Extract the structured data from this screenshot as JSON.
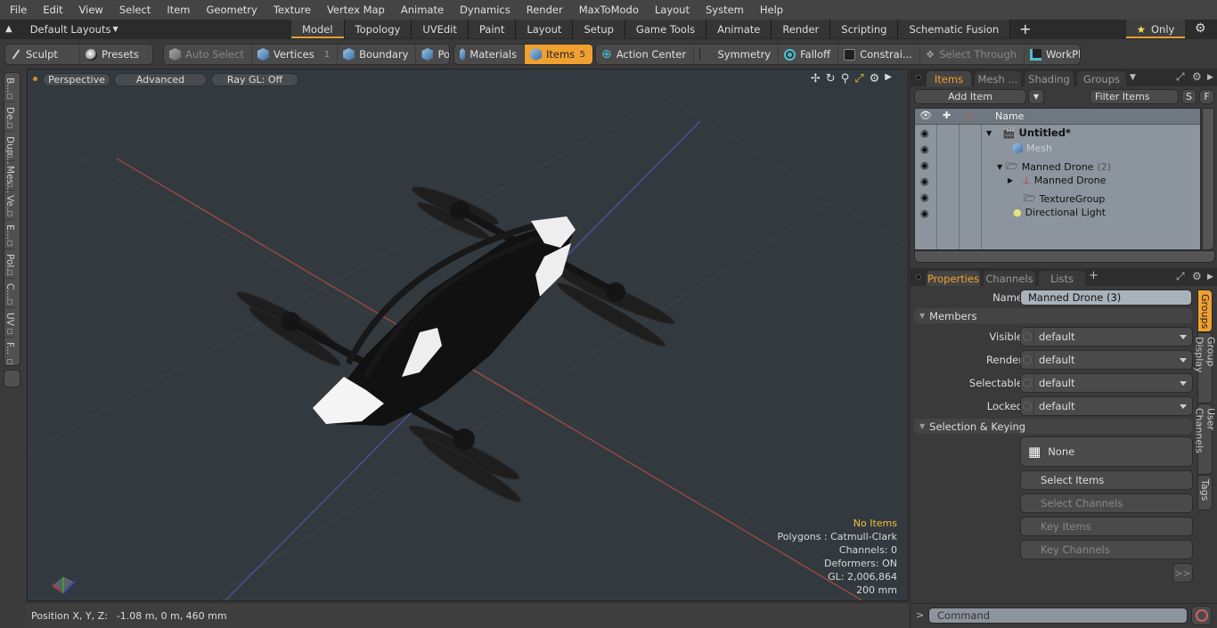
{
  "menu": [
    "File",
    "Edit",
    "View",
    "Select",
    "Item",
    "Geometry",
    "Texture",
    "Vertex Map",
    "Animate",
    "Dynamics",
    "Render",
    "MaxToModo",
    "Layout",
    "System",
    "Help"
  ],
  "layout_bar": {
    "layout_select": "Default Layouts",
    "tabs": [
      {
        "label": "Model",
        "active": true
      },
      {
        "label": "Topology"
      },
      {
        "label": "UVEdit"
      },
      {
        "label": "Paint"
      },
      {
        "label": "Layout"
      },
      {
        "label": "Setup"
      },
      {
        "label": "Game Tools"
      },
      {
        "label": "Animate"
      },
      {
        "label": "Render"
      },
      {
        "label": "Scripting"
      },
      {
        "label": "Schematic Fusion"
      }
    ],
    "add_tab": "+",
    "only_label": "Only"
  },
  "toolbar": {
    "sculpt": "Sculpt",
    "presets": "Presets",
    "auto_select": "Auto Select",
    "vertices": "Vertices",
    "vertices_count": "1",
    "boundary": "Boundary",
    "polygons": "Polygons",
    "materials": "Materials",
    "items": "Items",
    "items_count": "5",
    "action_center": "Action Center",
    "symmetry": "Symmetry",
    "falloff": "Falloff",
    "constraints": "Constrai...",
    "select_through": "Select Through",
    "workplane": "WorkPlane"
  },
  "left_tabs": [
    "B...",
    "De...",
    "Dup...",
    "Mes...",
    "Ve...",
    "E...",
    "Pol...",
    "C...",
    "UV",
    "F..."
  ],
  "viewport": {
    "view_mode": "Perspective",
    "shading": "Advanced",
    "raygl": "Ray GL: Off",
    "info": {
      "selection": "No Items",
      "polygons": "Polygons : Catmull-Clark",
      "channels": "Channels: 0",
      "deformers": "Deformers: ON",
      "gl": "GL: 2,006,864",
      "grid": "200 mm"
    },
    "colors": {
      "x_axis": "#c0503c",
      "z_axis": "#5060c0",
      "bg": "#333a3f"
    }
  },
  "status": {
    "label": "Position X, Y, Z:",
    "value": "-1.08 m, 0 m, 460 mm"
  },
  "items_panel": {
    "tabs": [
      {
        "label": "Items",
        "active": true
      },
      {
        "label": "Mesh ..."
      },
      {
        "label": "Shading"
      },
      {
        "label": "Groups"
      }
    ],
    "add_item": "Add Item",
    "filter_placeholder": "Filter Items",
    "s_btn": "S",
    "f_btn": "F",
    "name_header": "Name",
    "tree": [
      {
        "name": "Untitled*",
        "level": 0,
        "bold": true,
        "icon": "scene"
      },
      {
        "name": "Mesh",
        "level": 1,
        "dim": true,
        "icon": "mesh"
      },
      {
        "name": "Manned Drone",
        "count": "(2)",
        "level": 1,
        "icon": "group",
        "expanded": true
      },
      {
        "name": "Manned Drone",
        "level": 2,
        "icon": "locator",
        "collapsed": true
      },
      {
        "name": "TextureGroup",
        "level": 2,
        "icon": "group"
      },
      {
        "name": "Directional Light",
        "level": 1,
        "icon": "light"
      }
    ]
  },
  "properties_panel": {
    "tabs": [
      {
        "label": "Properties",
        "active": true
      },
      {
        "label": "Channels"
      },
      {
        "label": "Lists"
      }
    ],
    "add_tab": "+",
    "name_label": "Name",
    "name_value": "Manned Drone (3)",
    "members_section": "Members",
    "fields": [
      {
        "label": "Visible",
        "value": "default"
      },
      {
        "label": "Render",
        "value": "default"
      },
      {
        "label": "Selectable",
        "value": "default"
      },
      {
        "label": "Locked",
        "value": "default"
      }
    ],
    "keying_section": "Selection & Keying",
    "none_btn": "None",
    "select_items": "Select Items",
    "select_channels": "Select Channels",
    "key_items": "Key Items",
    "key_channels": "Key Channels",
    "more_btn": ">>",
    "side_tabs": [
      {
        "label": "Groups",
        "active": true
      },
      {
        "label": "Group Display"
      },
      {
        "label": "User Channels"
      },
      {
        "label": "Tags"
      }
    ]
  },
  "command": {
    "prompt": ">",
    "placeholder": "Command"
  },
  "accent_color": "#f0a030"
}
